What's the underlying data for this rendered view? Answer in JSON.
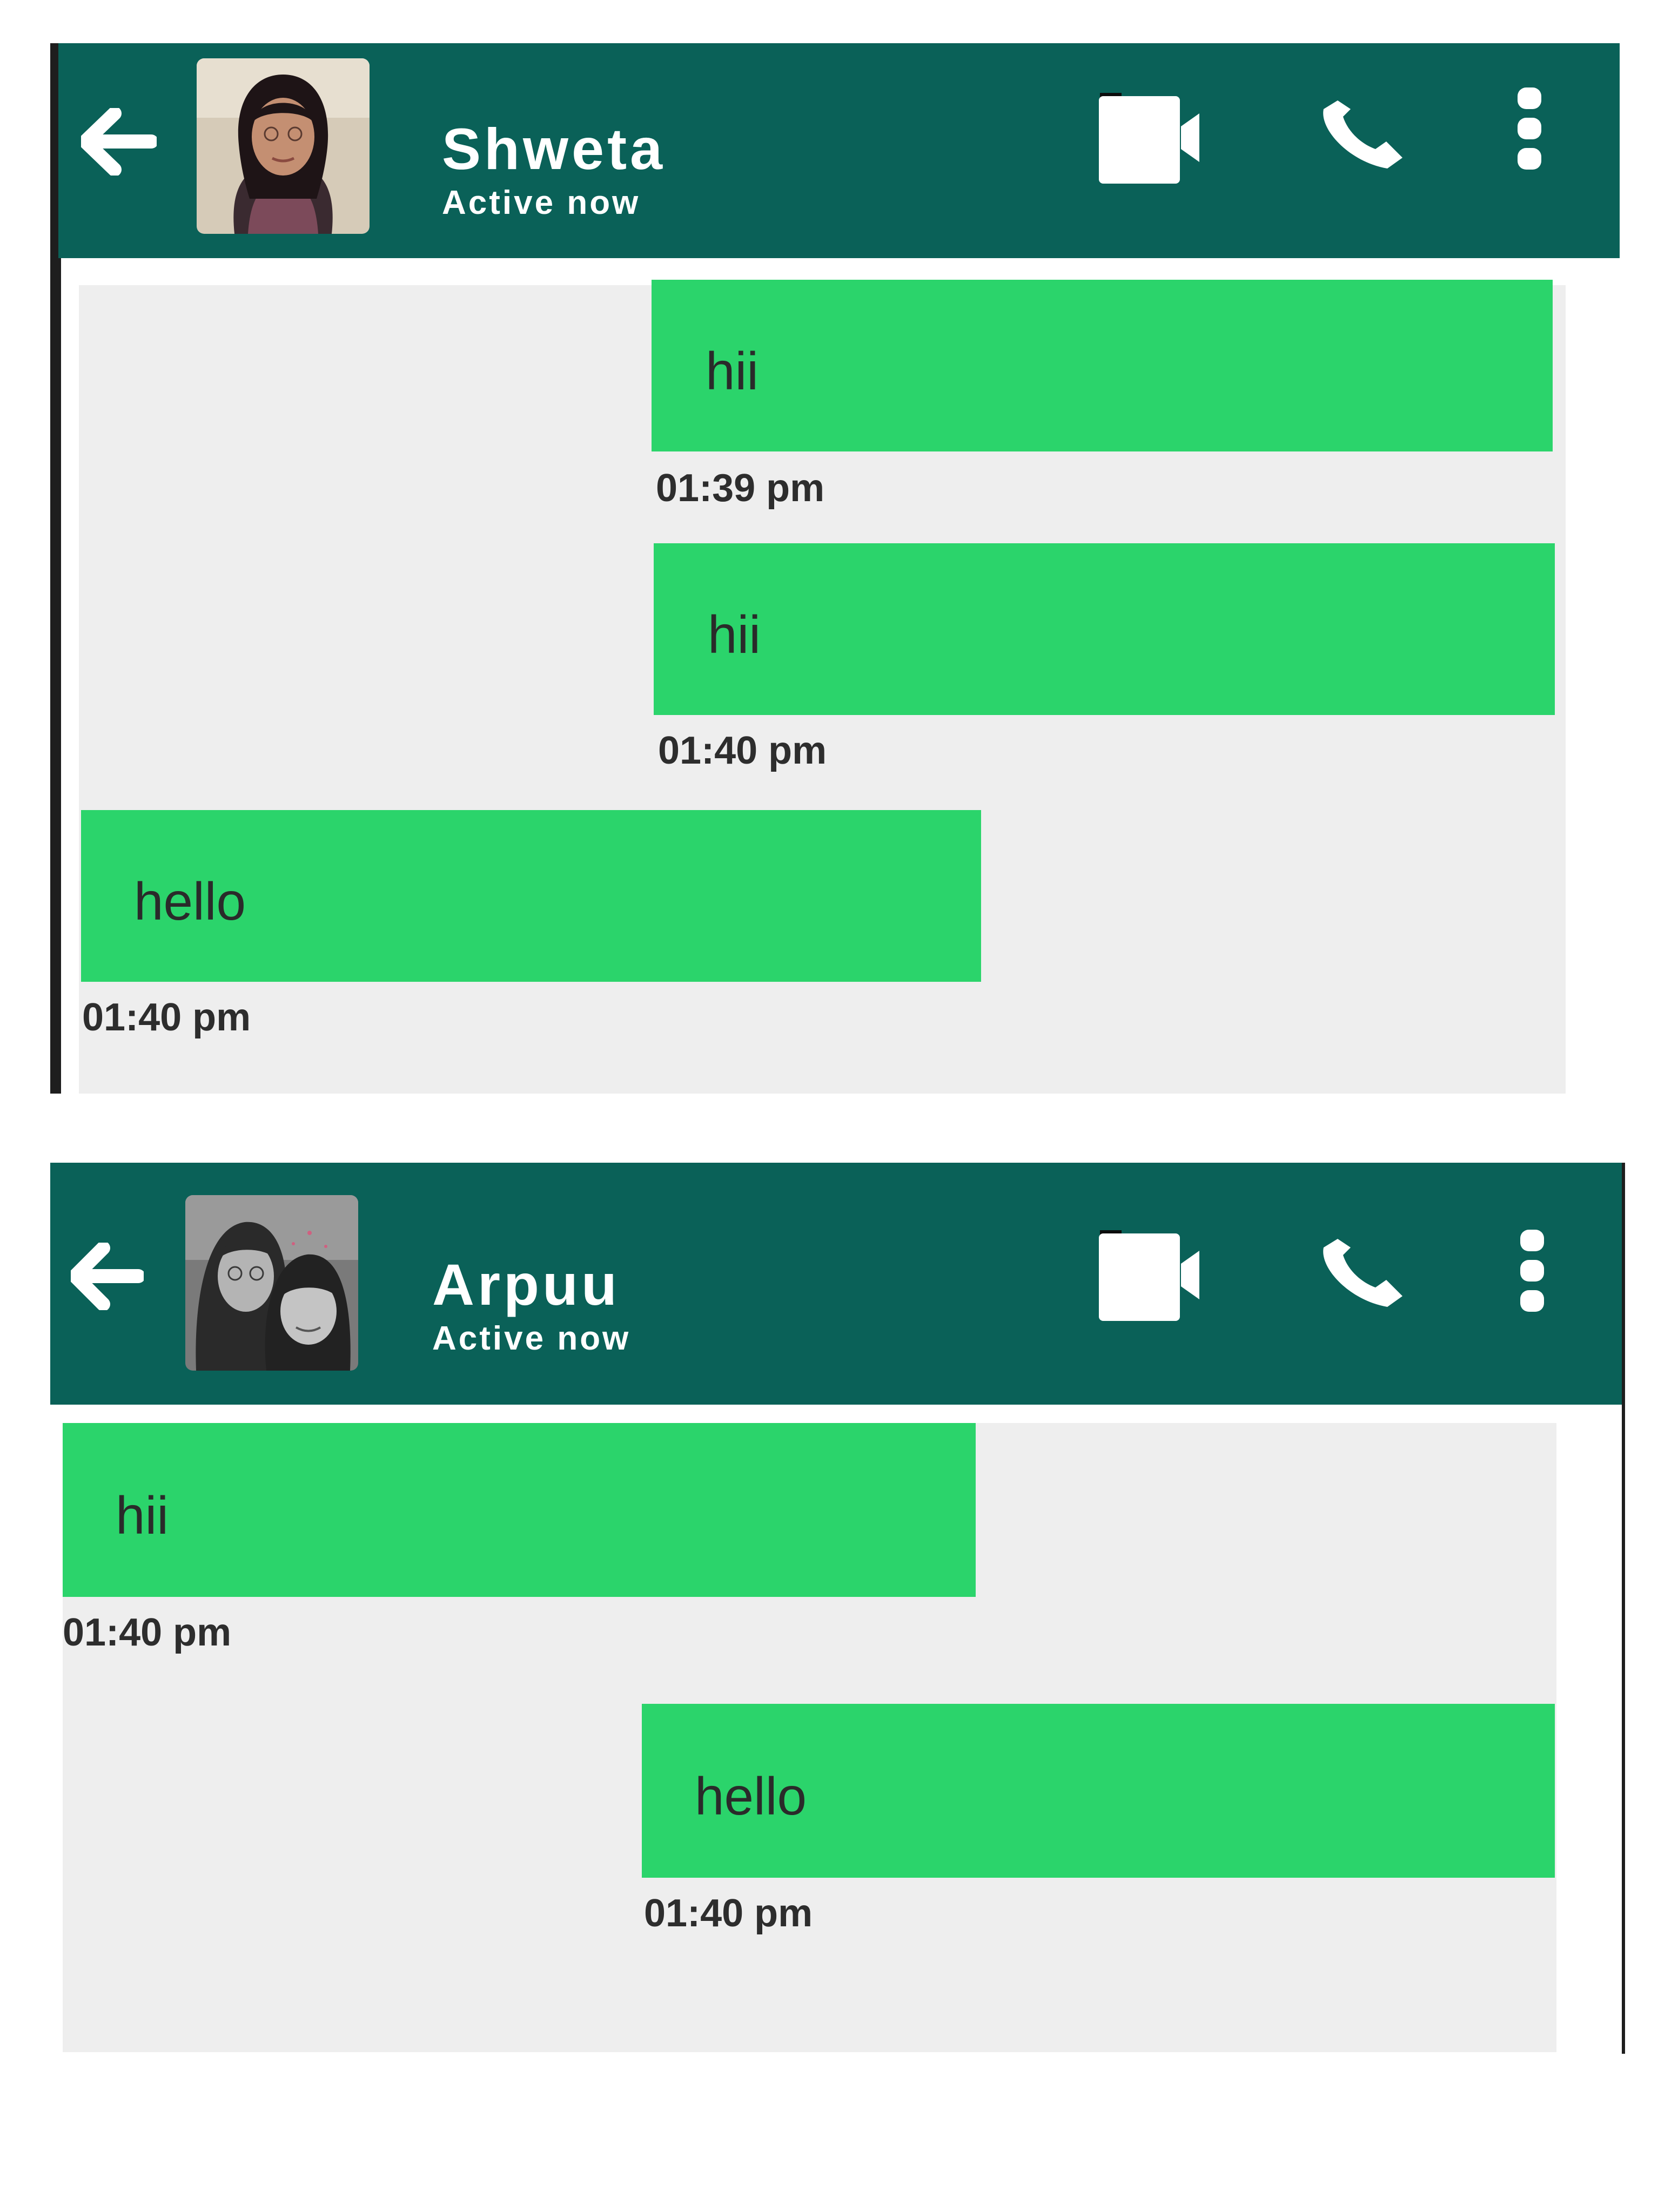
{
  "colors": {
    "header_bg": "#0a6158",
    "chat_bg": "#eeeeee",
    "bubble_bg": "#2bd46b",
    "header_text": "#ffffff",
    "timestamp_text": "#2d2d2d"
  },
  "chat1": {
    "contact_name": "Shweta",
    "status": "Active now",
    "icons": [
      "back-arrow-icon",
      "video-camera-icon",
      "phone-icon",
      "more-vertical-icon"
    ],
    "messages": [
      {
        "side": "sent",
        "text": "hii",
        "time": "01:39 pm"
      },
      {
        "side": "sent",
        "text": "hii",
        "time": "01:40 pm"
      },
      {
        "side": "received",
        "text": "hello",
        "time": "01:40 pm"
      }
    ]
  },
  "chat2": {
    "contact_name": "Arpuu",
    "status": "Active now",
    "icons": [
      "back-arrow-icon",
      "video-camera-icon",
      "phone-icon",
      "more-vertical-icon"
    ],
    "messages": [
      {
        "side": "received",
        "text": "hii",
        "time": "01:40 pm"
      },
      {
        "side": "sent",
        "text": "hello",
        "time": "01:40 pm"
      }
    ]
  }
}
